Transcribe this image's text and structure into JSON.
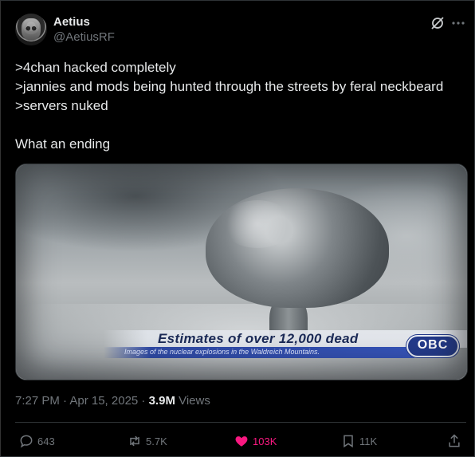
{
  "author": {
    "name": "Aetius",
    "handle": "@AetiusRF"
  },
  "tweet": {
    "lines": [
      ">4chan hacked completely",
      ">jannies and mods being hunted through the streets by feral neckbeard",
      ">servers nuked"
    ],
    "closing": "What an ending"
  },
  "media": {
    "headline": "Estimates of over 12,000 dead",
    "subline": "Images of the nuclear explosions in the Waldreich Mountains.",
    "logo": "OBC"
  },
  "meta": {
    "timestamp": "7:27 PM · Apr 15, 2025 · ",
    "views_count": "3.9M",
    "views_label": " Views"
  },
  "actions": {
    "replies": "643",
    "reposts": "5.7K",
    "likes": "103K",
    "bookmarks": "11K"
  },
  "icons": [
    "grok-icon",
    "more-icon",
    "reply-icon",
    "repost-icon",
    "heart-icon",
    "bookmark-icon",
    "share-icon"
  ],
  "colors": {
    "background": "#000000",
    "text": "#e7e9ea",
    "muted": "#71767b",
    "like": "#f91880",
    "border": "#2f3336"
  }
}
